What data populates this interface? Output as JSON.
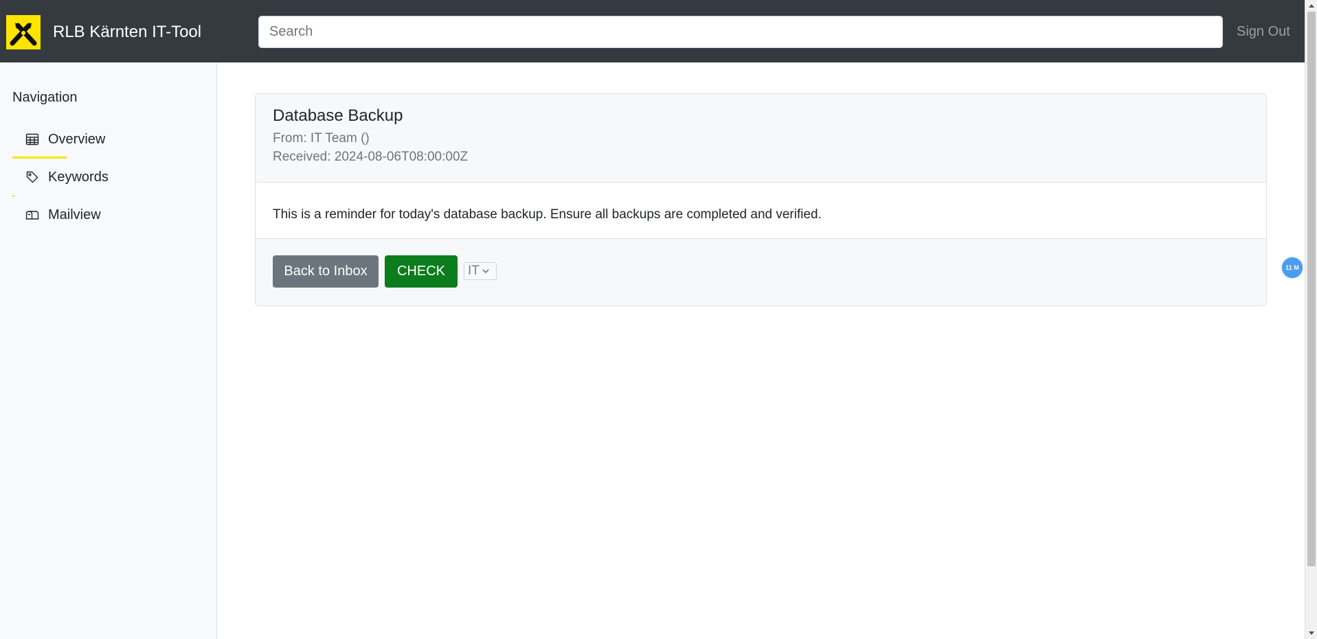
{
  "header": {
    "brand_title": "RLB Kärnten IT-Tool",
    "logo_icon": "raiffeisen-crossed-gables-logo",
    "search_placeholder": "Search",
    "search_value": "",
    "signout_label": "Sign Out"
  },
  "sidebar": {
    "heading": "Navigation",
    "items": [
      {
        "label": "Overview",
        "icon": "table-icon",
        "active": true
      },
      {
        "label": "Keywords",
        "icon": "tag-icon",
        "active": false
      },
      {
        "label": "Mailview",
        "icon": "mailbox-icon",
        "active": false
      }
    ]
  },
  "mail": {
    "subject": "Database Backup",
    "from": "From: IT Team ()",
    "received": "Received: 2024-08-06T08:00:00Z",
    "body": "This is a reminder for today's database backup. Ensure all backups are completed and verified."
  },
  "actions": {
    "back_label": "Back to Inbox",
    "check_label": "CHECK",
    "category_selected": "IT"
  },
  "floating_badge": {
    "label": "11 M"
  },
  "colors": {
    "navbar": "#343a40",
    "logo_yellow": "#ffe500",
    "active_underline": "#f5e600",
    "back_button": "#6c757d",
    "check_button": "#0b7d1c",
    "badge": "#4a9df0"
  }
}
